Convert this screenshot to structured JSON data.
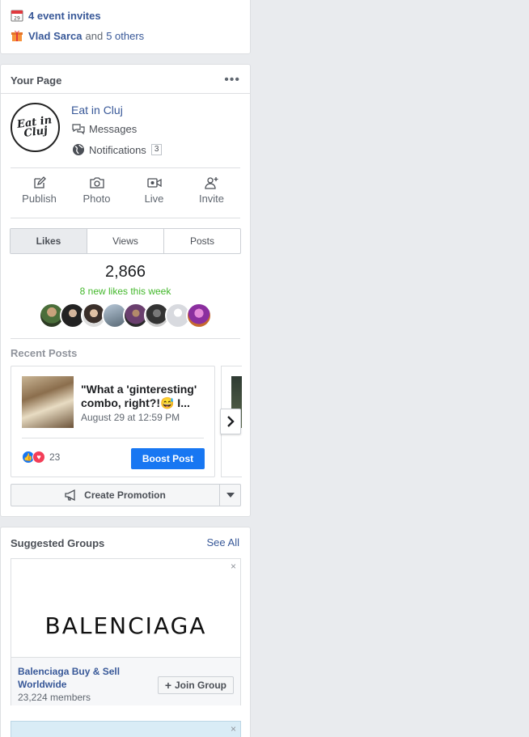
{
  "events": {
    "invites_text": "4 event invites",
    "birthday_name": "Vlad Sarca",
    "birthday_and": "and",
    "birthday_others": "5 others",
    "calendar_day": "29"
  },
  "your_page": {
    "title": "Your Page",
    "more": "•••",
    "page_name": "Eat in Cluj",
    "logo_text": "Eat in Cluj",
    "messages_label": "Messages",
    "notifications_label": "Notifications",
    "notifications_count": "3",
    "actions": [
      {
        "label": "Publish",
        "icon": "pencil-icon"
      },
      {
        "label": "Photo",
        "icon": "camera-icon"
      },
      {
        "label": "Live",
        "icon": "live-video-icon"
      },
      {
        "label": "Invite",
        "icon": "add-person-icon"
      }
    ],
    "tabs": [
      "Likes",
      "Views",
      "Posts"
    ],
    "active_tab": "Likes",
    "likes_total": "2,866",
    "likes_week": "8 new likes this week",
    "recent_posts_label": "Recent Posts",
    "post": {
      "title": "\"What a 'ginteresting' combo, right?!😅 I...",
      "date": "August 29 at 12:59 PM",
      "reaction_count": "23",
      "boost_label": "Boost Post"
    },
    "create_promotion_label": "Create Promotion",
    "colors": {
      "link": "#385898",
      "accent": "#1877f2",
      "green": "#42b72a"
    }
  },
  "suggested_groups": {
    "title": "Suggested Groups",
    "see_all": "See All",
    "close": "×",
    "groups": [
      {
        "brand": "BALENCIAGA",
        "name": "Balenciaga Buy & Sell Worldwide",
        "members": "23,224 members",
        "join_label": "Join Group"
      }
    ]
  }
}
